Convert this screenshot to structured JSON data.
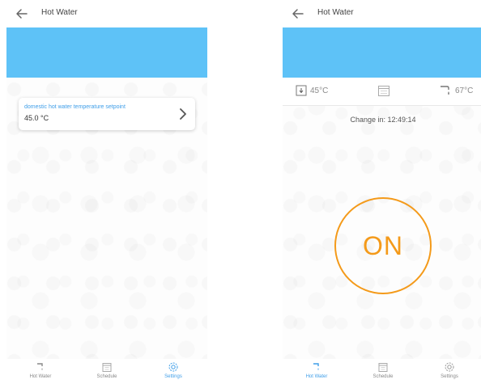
{
  "left": {
    "appbar": {
      "title": "Hot Water"
    },
    "setpoint_card": {
      "label": "domestic hot water temperature setpoint",
      "value": "45.0 °C"
    },
    "bottom_nav": [
      {
        "label": "Hot Water",
        "icon": "tap-icon",
        "active": false
      },
      {
        "label": "Schedule",
        "icon": "calendar-icon",
        "active": false
      },
      {
        "label": "Settings",
        "icon": "gear-icon",
        "active": true
      }
    ]
  },
  "right": {
    "appbar": {
      "title": "Hot Water"
    },
    "info_row": {
      "current_temp": "45°C",
      "target_temp": "67°C"
    },
    "change_in": "Change in: 12:49:14",
    "toggle": {
      "label": "ON"
    },
    "bottom_nav": [
      {
        "label": "Hot Water",
        "icon": "tap-icon",
        "active": true
      },
      {
        "label": "Schedule",
        "icon": "calendar-icon",
        "active": false
      },
      {
        "label": "Settings",
        "icon": "gear-icon",
        "active": false
      }
    ]
  },
  "colors": {
    "banner": "#5ec2f7",
    "accent_blue": "#3f9ee8",
    "accent_orange": "#f49a1a"
  }
}
